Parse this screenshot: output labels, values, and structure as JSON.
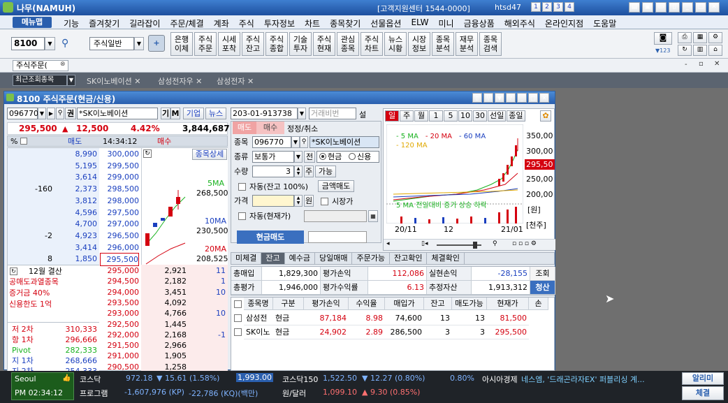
{
  "titlebar": {
    "app_title": "나무(NAMUH)",
    "center_info": "[고객지원센터 1544-0000]",
    "user": "htsd47",
    "screens": [
      "1",
      "2",
      "3",
      "4"
    ]
  },
  "menubar": {
    "menu_button": "메뉴맵",
    "items": [
      "기능",
      "즐겨찾기",
      "길라잡이",
      "주문/체결",
      "계좌",
      "주식",
      "투자정보",
      "차트",
      "종목찾기",
      "선물옵션",
      "ELW",
      "미니",
      "금융상품",
      "해외주식",
      "온라인지점",
      "도움말"
    ]
  },
  "toolbar": {
    "screen_code": "8100",
    "category": "주식일반",
    "buttons": [
      [
        "은행",
        "이체"
      ],
      [
        "주식",
        "주문"
      ],
      [
        "시세",
        "포착"
      ],
      [
        "주식",
        "잔고"
      ],
      [
        "주식",
        "종합"
      ],
      [
        "기술",
        "투자"
      ],
      [
        "주식",
        "현재"
      ],
      [
        "관심",
        "종목"
      ],
      [
        "주식",
        "차트"
      ],
      [
        "뉴스",
        "시황"
      ],
      [
        "시장",
        "정보"
      ],
      [
        "종목",
        "분석"
      ],
      [
        "재무",
        "분석"
      ],
      [
        "종목",
        "검색"
      ]
    ],
    "right_label": "▼123"
  },
  "tabbar1": {
    "tab": "주식주문("
  },
  "tabbar2": {
    "recent_label": "최근조회종목",
    "tabs": [
      "SK이노베이션",
      "삼성전자우",
      "삼성전자"
    ]
  },
  "window": {
    "title": "8100 주식주문(현금/신용)",
    "title_btn": "푸",
    "stock_code": "096770",
    "stock_button": "권",
    "stock_name": "*SK이노베이션",
    "gi": "기",
    "m": "M",
    "gieop": "기업",
    "news": "뉴스",
    "price": "295,500",
    "change_arrow": "▲",
    "change": "12,500",
    "change_pct": "4.42%",
    "volume": "3,844,687",
    "ob_header": {
      "pct": "%",
      "sell": "매도",
      "time": "14:34:12",
      "buy": "매수"
    },
    "ask_rows": [
      {
        "qty": "8,990",
        "diff": "",
        "price": "300,000"
      },
      {
        "qty": "5,195",
        "diff": "",
        "price": "299,500"
      },
      {
        "qty": "3,614",
        "diff": "",
        "price": "299,000"
      },
      {
        "qty": "2,373",
        "diff": "-160",
        "price": "298,500"
      },
      {
        "qty": "3,812",
        "diff": "",
        "price": "298,000"
      },
      {
        "qty": "4,596",
        "diff": "",
        "price": "297,500"
      },
      {
        "qty": "4,700",
        "diff": "",
        "price": "297,000"
      },
      {
        "qty": "4,923",
        "diff": "-2",
        "price": "296,500"
      },
      {
        "qty": "3,414",
        "diff": "",
        "price": "296,000"
      },
      {
        "qty": "1,850",
        "diff": "8",
        "price": "295,500"
      }
    ],
    "bid_rows": [
      {
        "price": "295,000",
        "qty": "2,921",
        "diff": "11"
      },
      {
        "price": "294,500",
        "qty": "2,182",
        "diff": "1"
      },
      {
        "price": "294,000",
        "qty": "3,451",
        "diff": "10"
      },
      {
        "price": "293,500",
        "qty": "4,092",
        "diff": ""
      },
      {
        "price": "293,000",
        "qty": "4,766",
        "diff": "10"
      },
      {
        "price": "292,500",
        "qty": "1,445",
        "diff": ""
      },
      {
        "price": "292,000",
        "qty": "2,168",
        "diff": "-1"
      },
      {
        "price": "291,500",
        "qty": "2,966",
        "diff": ""
      },
      {
        "price": "291,000",
        "qty": "1,905",
        "diff": ""
      },
      {
        "price": "290,500",
        "qty": "1,258",
        "diff": ""
      }
    ],
    "mini_chart": {
      "button": "종목상세",
      "ma5_label": "5MA",
      "ma5_val": "268,500",
      "ma10_label": "10MA",
      "ma10_val": "230,500",
      "ma20_label": "20MA",
      "ma20_val": "208,525"
    },
    "info_left": {
      "settle": "12월 결산",
      "lines": [
        "공매도과열종목",
        "증거금 40%",
        "신용한도 1억"
      ]
    },
    "pivot": [
      {
        "label": "저 2차",
        "val": "310,333"
      },
      {
        "label": "항 1차",
        "val": "296,666"
      },
      {
        "label": "Pivot",
        "val": "282,333"
      },
      {
        "label": "지 1차",
        "val": "268,666"
      },
      {
        "label": "지 2차",
        "val": "254,333"
      }
    ],
    "order": {
      "account": "203-01-913738",
      "account_name": "거래비번",
      "seol": "설",
      "tab_sell": "매도",
      "tab_buy": "매수",
      "tab_modify": "정정/취소",
      "code_label": "종목",
      "code": "096770",
      "name": "*SK이노베이션",
      "type_label": "종류",
      "type": "보통가",
      "jeon": "전",
      "cash": "현금",
      "credit": "신용",
      "qty_label": "수량",
      "qty": "3",
      "ju": "주",
      "ganeung": "가능",
      "auto1": "자동(잔고 100%)",
      "amount_sell": "금액매도",
      "price_label": "가격",
      "won": "원",
      "market": "시장가",
      "auto2": "자동(현재가)",
      "submit": "현금매도"
    },
    "chart": {
      "tabs": [
        "일",
        "주",
        "월",
        "1",
        "5",
        "10",
        "30",
        "선일",
        "종일"
      ],
      "legend": [
        {
          "name": "5 MA",
          "color": "#19b21f"
        },
        {
          "name": "20 MA",
          "color": "#d4000f"
        },
        {
          "name": "60 MA",
          "color": "#1a3fbf"
        },
        {
          "name": "120 MA",
          "color": "#e0a800"
        }
      ],
      "y_ticks": [
        "350,00",
        "300,00",
        "250,00",
        "200,00"
      ],
      "current": "295,50",
      "unit1": "[원]",
      "vol_legend": "5 MA 전일대비 증가 상승 하락",
      "unit2": "[천주]",
      "x_ticks": [
        "20/11",
        "12",
        "21/01"
      ]
    },
    "bottom_tabs": [
      "미체결",
      "잔고",
      "예수금",
      "당일매매",
      "주문가능",
      "잔고확인",
      "체결확인"
    ],
    "summary": {
      "r1": [
        "총매입",
        "1,829,300",
        "평가손익",
        "112,086",
        "실현손익",
        "-28,155",
        "조회"
      ],
      "r2": [
        "총평가",
        "1,946,000",
        "평가수익률",
        "6.13",
        "추정자산",
        "1,913,312",
        "청산"
      ]
    },
    "grid": {
      "headers": [
        "종목명",
        "구분",
        "평가손익",
        "수익율",
        "매입가",
        "잔고",
        "매도가능",
        "현재가",
        "손"
      ],
      "rows": [
        [
          "삼성전자우",
          "현금",
          "87,184",
          "8.98",
          "74,600",
          "13",
          "13",
          "81,500"
        ],
        [
          "SK이노베이",
          "현금",
          "24,902",
          "2.89",
          "286,500",
          "3",
          "3",
          "295,500"
        ]
      ]
    }
  },
  "statusbar": {
    "city": "Seoul",
    "time": "PM 02:34:12",
    "kospi_label": "코스닥",
    "kospi": "972.18",
    "kospi_chg": "▼ 15.61 (1.58%)",
    "kospi_box": "1,993.00",
    "k150_label": "코스닥150",
    "k150": "1,522.50",
    "k150_chg": "▼ 12.27 (0.80%)",
    "pct": "0.80%",
    "news_label": "아시아경제",
    "news": "네스엠, '드래곤라자EX' 퍼블리싱 계...",
    "prog_label": "프로그램",
    "prog_kp": "-1,607,976 (KP)",
    "prog_kq": "-22,786 (KQ)(백만)",
    "fx_label": "원/달러",
    "fx": "1,099.10",
    "fx_chg": "▲ 9.30 (0.85%)",
    "alimi": "알리미",
    "chegyul": "체결"
  },
  "colors": {
    "title_blue": "#2a5fae",
    "up_red": "#d4000f",
    "down_blue": "#1a3fbf",
    "sell_tab": "#f0a3a3"
  }
}
